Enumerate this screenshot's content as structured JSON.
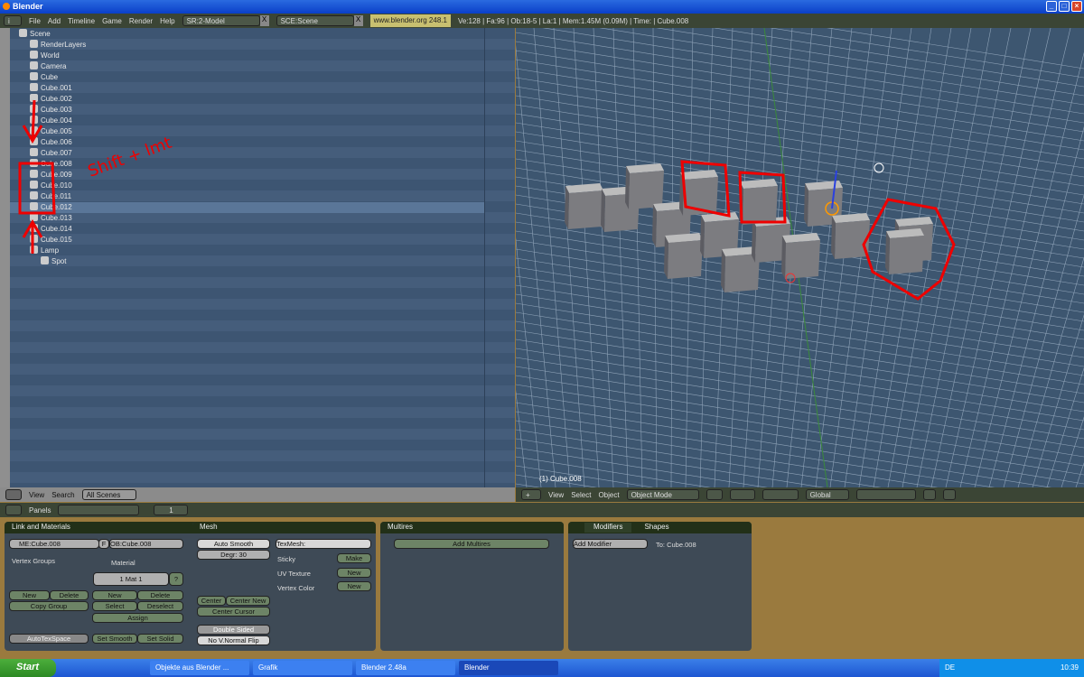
{
  "window": {
    "title": "Blender"
  },
  "topbar": {
    "menus": [
      "File",
      "Add",
      "Timeline",
      "Game",
      "Render",
      "Help"
    ],
    "screen": "SR:2-Model",
    "scene": "SCE:Scene",
    "url": "www.blender.org 248.1",
    "stats": "Ve:128 | Fa:96 | Ob:18-5 | La:1  | Mem:1.45M (0.09M)  | Time: | Cube.008"
  },
  "outliner": {
    "items": [
      {
        "label": "Scene",
        "indent": 0
      },
      {
        "label": "RenderLayers",
        "indent": 1
      },
      {
        "label": "World",
        "indent": 1
      },
      {
        "label": "Camera",
        "indent": 1
      },
      {
        "label": "Cube",
        "indent": 1
      },
      {
        "label": "Cube.001",
        "indent": 1
      },
      {
        "label": "Cube.002",
        "indent": 1
      },
      {
        "label": "Cube.003",
        "indent": 1
      },
      {
        "label": "Cube.004",
        "indent": 1
      },
      {
        "label": "Cube.005",
        "indent": 1
      },
      {
        "label": "Cube.006",
        "indent": 1
      },
      {
        "label": "Cube.007",
        "indent": 1
      },
      {
        "label": "Cube.008",
        "indent": 1
      },
      {
        "label": "Cube.009",
        "indent": 1
      },
      {
        "label": "Cube.010",
        "indent": 1
      },
      {
        "label": "Cube.011",
        "indent": 1
      },
      {
        "label": "Cube.012",
        "indent": 1,
        "active": true
      },
      {
        "label": "Cube.013",
        "indent": 1
      },
      {
        "label": "Cube.014",
        "indent": 1
      },
      {
        "label": "Cube.015",
        "indent": 1
      },
      {
        "label": "Lamp",
        "indent": 1
      },
      {
        "label": "Spot",
        "indent": 2
      }
    ],
    "annotation": "Shift + lmt",
    "header": {
      "view": "View",
      "search": "Search",
      "scope": "All Scenes"
    }
  },
  "viewport": {
    "object_label": "(1) Cube.008",
    "header": {
      "view": "View",
      "select": "Select",
      "object": "Object",
      "mode": "Object Mode",
      "orientation": "Global"
    }
  },
  "buttons_header": {
    "panels": "Panels",
    "frame": "1"
  },
  "link_materials": {
    "title": "Link and Materials",
    "mesh": "ME:Cube.008",
    "f": "F",
    "object": "OB:Cube.008",
    "vertex_groups": "Vertex Groups",
    "material": "Material",
    "mat": "1 Mat 1",
    "q": "?",
    "vg_new": "New",
    "vg_delete": "Delete",
    "copy_group": "Copy Group",
    "m_new": "New",
    "m_delete": "Delete",
    "m_select": "Select",
    "m_deselect": "Deselect",
    "assign": "Assign",
    "autotex": "AutoTexSpace",
    "set_smooth": "Set Smooth",
    "set_solid": "Set Solid"
  },
  "mesh": {
    "title": "Mesh",
    "auto_smooth": "Auto Smooth",
    "degr": "Degr: 30",
    "texmesh": "TexMesh:",
    "sticky": "Sticky",
    "make": "Make",
    "uv": "UV Texture",
    "uv_new": "New",
    "vcol": "Vertex Color",
    "vcol_new": "New",
    "center": "Center",
    "center_new": "Center New",
    "center_cursor": "Center Cursor",
    "double_sided": "Double Sided",
    "no_vnormal": "No V.Normal Flip"
  },
  "multires": {
    "title": "Multires",
    "add": "Add Multires"
  },
  "modifiers": {
    "tab1": "Modifiers",
    "tab2": "Shapes",
    "add": "Add Modifier",
    "to": "To: Cube.008"
  },
  "taskbar": {
    "start": "Start",
    "tasks": [
      "Objekte aus Blender ...",
      "Grafik",
      "Blender 2.48a",
      "Blender"
    ],
    "lang": "DE",
    "clock": "10:39"
  }
}
